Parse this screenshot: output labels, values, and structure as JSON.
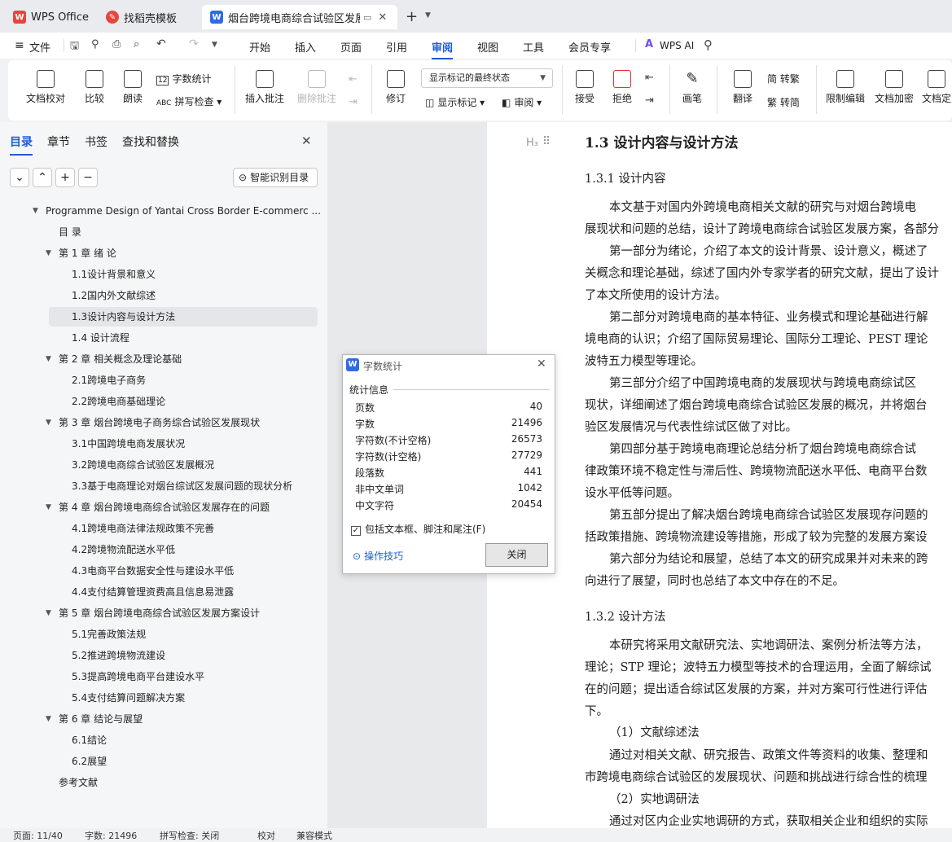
{
  "titlebar": {
    "tabs": [
      {
        "label": "WPS Office",
        "icon": "wps-logo-icon"
      },
      {
        "label": "找稻壳模板",
        "icon": "docer-icon"
      },
      {
        "label": "烟台跨境电商综合试验区发展方",
        "icon": "word-doc-icon"
      }
    ],
    "new_tab": "+"
  },
  "menubar": {
    "file": "文件",
    "items": [
      "开始",
      "插入",
      "页面",
      "引用",
      "审阅",
      "视图",
      "工具",
      "会员专享"
    ],
    "active": "审阅",
    "ai": "WPS AI"
  },
  "ribbon": {
    "doc_check": "文档校对",
    "compare": "比较",
    "read_aloud": "朗读",
    "word_count": "字数统计",
    "spell_check": "拼写检查",
    "insert_comment": "插入批注",
    "delete_comment": "删除批注",
    "revise": "修订",
    "markup_state": "显示标记的最终状态",
    "show_markup": "显示标记",
    "review_pane": "审阅",
    "accept": "接受",
    "reject": "拒绝",
    "pen": "画笔",
    "translate": "翻译",
    "to_traditional": "简 转繁",
    "to_simplified": "繁 转简",
    "restrict_edit": "限制编辑",
    "encrypt": "文档加密",
    "finalize": "文档定"
  },
  "left_panel": {
    "tabs": [
      "目录",
      "章节",
      "书签",
      "查找和替换"
    ],
    "smart_btn": "智能识别目录",
    "toc": [
      {
        "label": "Programme Design of Yantai Cross Border E-commerc ...",
        "level": 0,
        "arrow": true
      },
      {
        "label": "目  录",
        "level": 1,
        "arrow": false
      },
      {
        "label": "第 1 章  绪  论",
        "level": 1,
        "arrow": true
      },
      {
        "label": "1.1设计背景和意义",
        "level": 2,
        "arrow": false
      },
      {
        "label": "1.2国内外文献综述",
        "level": 2,
        "arrow": false
      },
      {
        "label": "1.3设计内容与设计方法",
        "level": 2,
        "arrow": false,
        "selected": true
      },
      {
        "label": "1.4 设计流程",
        "level": 2,
        "arrow": false
      },
      {
        "label": "第 2 章  相关概念及理论基础",
        "level": 1,
        "arrow": true
      },
      {
        "label": "2.1跨境电子商务",
        "level": 2,
        "arrow": false
      },
      {
        "label": "2.2跨境电商基础理论",
        "level": 2,
        "arrow": false
      },
      {
        "label": "第 3 章  烟台跨境电子商务综合试验区发展现状",
        "level": 1,
        "arrow": true
      },
      {
        "label": "3.1中国跨境电商发展状况",
        "level": 2,
        "arrow": false
      },
      {
        "label": "3.2跨境电商综合试验区发展概况",
        "level": 2,
        "arrow": false
      },
      {
        "label": "3.3基于电商理论对烟台综试区发展问题的现状分析",
        "level": 2,
        "arrow": false
      },
      {
        "label": "第 4 章  烟台跨境电商综合试验区发展存在的问题",
        "level": 1,
        "arrow": true
      },
      {
        "label": "4.1跨境电商法律法规政策不完善",
        "level": 2,
        "arrow": false
      },
      {
        "label": "4.2跨境物流配送水平低",
        "level": 2,
        "arrow": false
      },
      {
        "label": "4.3电商平台数据安全性与建设水平低",
        "level": 2,
        "arrow": false
      },
      {
        "label": "4.4支付结算管理资费高且信息易泄露",
        "level": 2,
        "arrow": false
      },
      {
        "label": "第 5 章  烟台跨境电商综合试验区发展方案设计",
        "level": 1,
        "arrow": true
      },
      {
        "label": "5.1完善政策法规",
        "level": 2,
        "arrow": false
      },
      {
        "label": "5.2推进跨境物流建设",
        "level": 2,
        "arrow": false
      },
      {
        "label": "5.3提高跨境电商平台建设水平",
        "level": 2,
        "arrow": false
      },
      {
        "label": "5.4支付结算问题解决方案",
        "level": 2,
        "arrow": false
      },
      {
        "label": "第 6 章  结论与展望",
        "level": 1,
        "arrow": true
      },
      {
        "label": "6.1结论",
        "level": 2,
        "arrow": false
      },
      {
        "label": "6.2展望",
        "level": 2,
        "arrow": false
      },
      {
        "label": "参考文献",
        "level": 1,
        "arrow": false
      }
    ]
  },
  "document": {
    "heading_marker": "H₃",
    "lines": [
      {
        "text": "1.3  设计内容与设计方法",
        "kind": "h2",
        "indent": 0
      },
      {
        "text": "1.3.1  设计内容",
        "kind": "h3",
        "indent": 0
      },
      {
        "text": "本文基于对国内外跨境电商相关文献的研究与对烟台跨境电",
        "kind": "p",
        "indent": 1
      },
      {
        "text": "展现状和问题的总结，设计了跨境电商综合试验区发展方案，各部分",
        "kind": "p",
        "indent": 0
      },
      {
        "text": "第一部分为绪论，介绍了本文的设计背景、设计意义，概述了",
        "kind": "p",
        "indent": 1
      },
      {
        "text": "关概念和理论基础，综述了国内外专家学者的研究文献，提出了设计",
        "kind": "p",
        "indent": 0
      },
      {
        "text": "了本文所使用的设计方法。",
        "kind": "p",
        "indent": 0
      },
      {
        "text": "第二部分对跨境电商的基本特征、业务模式和理论基础进行解",
        "kind": "p",
        "indent": 1
      },
      {
        "text": "境电商的认识；介绍了国际贸易理论、国际分工理论、PEST 理论",
        "kind": "p",
        "indent": 0
      },
      {
        "text": "波特五力模型等理论。",
        "kind": "p",
        "indent": 0
      },
      {
        "text": "第三部分介绍了中国跨境电商的发展现状与跨境电商综试区",
        "kind": "p",
        "indent": 1
      },
      {
        "text": "现状，详细阐述了烟台跨境电商综合试验区发展的概况，并将烟台",
        "kind": "p",
        "indent": 0
      },
      {
        "text": "验区发展情况与代表性综试区做了对比。",
        "kind": "p",
        "indent": 0
      },
      {
        "text": "第四部分基于跨境电商理论总结分析了烟台跨境电商综合试",
        "kind": "p",
        "indent": 1
      },
      {
        "text": "律政策环境不稳定性与滞后性、跨境物流配送水平低、电商平台数",
        "kind": "p",
        "indent": 0
      },
      {
        "text": "设水平低等问题。",
        "kind": "p",
        "indent": 0
      },
      {
        "text": "第五部分提出了解决烟台跨境电商综合试验区发展现存问题的",
        "kind": "p",
        "indent": 1
      },
      {
        "text": "括政策措施、跨境物流建设等措施，形成了较为完整的发展方案设",
        "kind": "p",
        "indent": 0
      },
      {
        "text": "第六部分为结论和展望，总结了本文的研究成果并对未来的跨",
        "kind": "p",
        "indent": 1
      },
      {
        "text": "向进行了展望，同时也总结了本文中存在的不足。",
        "kind": "p",
        "indent": 0
      },
      {
        "text": "1.3.2  设计方法",
        "kind": "h3",
        "indent": 0
      },
      {
        "text": "本研究将采用文献研究法、实地调研法、案例分析法等方法，",
        "kind": "p",
        "indent": 1
      },
      {
        "text": "理论；STP 理论；波特五力模型等技术的合理运用，全面了解综试",
        "kind": "p",
        "indent": 0
      },
      {
        "text": "在的问题；提出适合综试区发展的方案，并对方案可行性进行评估",
        "kind": "p",
        "indent": 0
      },
      {
        "text": "下。",
        "kind": "p",
        "indent": 0
      },
      {
        "text": "（1）文献综述法",
        "kind": "p",
        "indent": 1
      },
      {
        "text": "通过对相关文献、研究报告、政策文件等资料的收集、整理和",
        "kind": "p",
        "indent": 1
      },
      {
        "text": "市跨境电商综合试验区的发展现状、问题和挑战进行综合性的梳理",
        "kind": "p",
        "indent": 0
      },
      {
        "text": "（2）实地调研法",
        "kind": "p",
        "indent": 1
      },
      {
        "text": "通过对区内企业实地调研的方式，获取相关企业和组织的实际",
        "kind": "p",
        "indent": 1
      }
    ]
  },
  "dialog": {
    "title": "字数统计",
    "section": "统计信息",
    "rows": [
      {
        "label": "页数",
        "value": "40"
      },
      {
        "label": "字数",
        "value": "21496"
      },
      {
        "label": "字符数(不计空格)",
        "value": "26573"
      },
      {
        "label": "字符数(计空格)",
        "value": "27729"
      },
      {
        "label": "段落数",
        "value": "441"
      },
      {
        "label": "非中文单词",
        "value": "1042"
      },
      {
        "label": "中文字符",
        "value": "20454"
      }
    ],
    "checkbox": "包括文本框、脚注和尾注(F)",
    "tips": "操作技巧",
    "close": "关闭"
  },
  "statusbar": {
    "page": "页面: 11/40",
    "words": "字数: 21496",
    "spell": "拼写检查: 关闭",
    "proof": "校对",
    "compat": "兼容模式"
  },
  "colors": {
    "accent": "#1e5bd8",
    "wps_red": "#e8453c",
    "word_blue": "#2e6be6"
  }
}
